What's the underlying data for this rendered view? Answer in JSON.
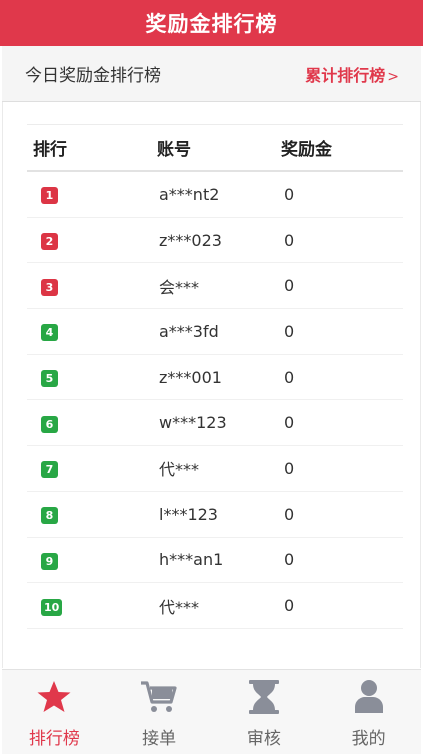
{
  "header": {
    "title": "奖励金排行榜"
  },
  "subbar": {
    "today_label": "今日奖励金排行榜",
    "cumulative_label": "累计排行榜",
    "cumulative_arrow": ">"
  },
  "table": {
    "headers": {
      "rank": "排行",
      "account": "账号",
      "reward": "奖励金"
    },
    "rows": [
      {
        "rank": "1",
        "account": "a***nt2",
        "reward": "0",
        "badge_color": "#dc3545"
      },
      {
        "rank": "2",
        "account": "z***023",
        "reward": "0",
        "badge_color": "#dc3545"
      },
      {
        "rank": "3",
        "account": "会***",
        "reward": "0",
        "badge_color": "#dc3545"
      },
      {
        "rank": "4",
        "account": "a***3fd",
        "reward": "0",
        "badge_color": "#28a745"
      },
      {
        "rank": "5",
        "account": "z***001",
        "reward": "0",
        "badge_color": "#28a745"
      },
      {
        "rank": "6",
        "account": "w***123",
        "reward": "0",
        "badge_color": "#28a745"
      },
      {
        "rank": "7",
        "account": "代***",
        "reward": "0",
        "badge_color": "#28a745"
      },
      {
        "rank": "8",
        "account": "l***123",
        "reward": "0",
        "badge_color": "#28a745"
      },
      {
        "rank": "9",
        "account": "h***an1",
        "reward": "0",
        "badge_color": "#28a745"
      },
      {
        "rank": "10",
        "account": "代***",
        "reward": "0",
        "badge_color": "#28a745"
      }
    ]
  },
  "tabbar": {
    "items": [
      {
        "label": "排行榜",
        "icon": "star-icon",
        "active": true
      },
      {
        "label": "接单",
        "icon": "cart-icon",
        "active": false
      },
      {
        "label": "审核",
        "icon": "hourglass-icon",
        "active": false
      },
      {
        "label": "我的",
        "icon": "user-icon",
        "active": false
      }
    ]
  },
  "colors": {
    "accent": "#e0384b",
    "rank_top": "#dc3545",
    "rank_other": "#28a745",
    "icon_inactive": "#8a8e99"
  }
}
